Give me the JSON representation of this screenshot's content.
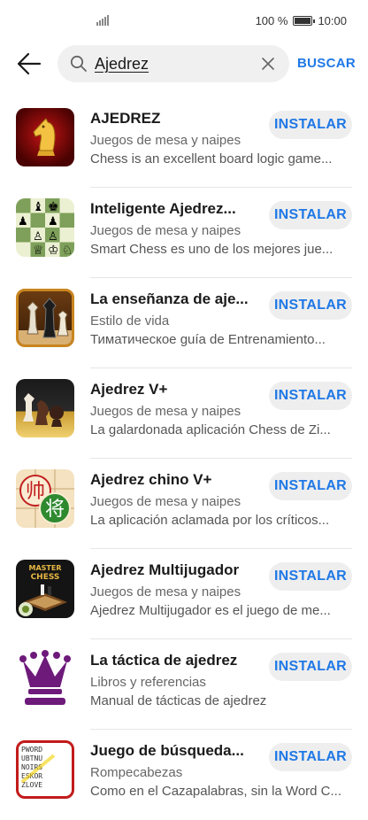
{
  "status_bar": {
    "battery": "100 %",
    "time": "10:00"
  },
  "search": {
    "query": "Ajedrez",
    "action_label": "BUSCAR"
  },
  "results": [
    {
      "title": "AJEDREZ",
      "category": "Juegos de mesa y naipes",
      "description": "Chess is an excellent board logic game...",
      "button": "INSTALAR"
    },
    {
      "title": "Inteligente Ajedrez...",
      "category": "Juegos de mesa y naipes",
      "description": "Smart Chess es uno de los mejores jue...",
      "button": "INSTALAR"
    },
    {
      "title": "La enseñanza de aje...",
      "category": "Estilo de vida",
      "description": "Тиматическое guía de Entrenamiento...",
      "button": "INSTALAR"
    },
    {
      "title": "Ajedrez V+",
      "category": "Juegos de mesa y naipes",
      "description": "La galardonada aplicación Chess de Zi...",
      "button": "INSTALAR"
    },
    {
      "title": "Ajedrez chino V+",
      "category": "Juegos de mesa y naipes",
      "description": "La aplicación aclamada por los críticos...",
      "button": "INSTALAR"
    },
    {
      "title": "Ajedrez Multijugador",
      "category": "Juegos de mesa y naipes",
      "description": "Ajedrez Multijugador es el juego de me...",
      "button": "INSTALAR"
    },
    {
      "title": "La táctica de ajedrez",
      "category": "Libros y referencias",
      "description": "Manual de tácticas de ajedrez",
      "button": "INSTALAR"
    },
    {
      "title": "Juego de búsqueda...",
      "category": "Rompecabezas",
      "description": "Como en el Cazapalabras, sin la Word C...",
      "button": "INSTALAR"
    }
  ],
  "icon_text": {
    "chinese_1": "帅",
    "chinese_2": "将",
    "master_1": "MASTER",
    "master_2": "CHESS"
  },
  "colors": {
    "accent": "#1f78e6",
    "button_bg": "#eeeeee"
  }
}
